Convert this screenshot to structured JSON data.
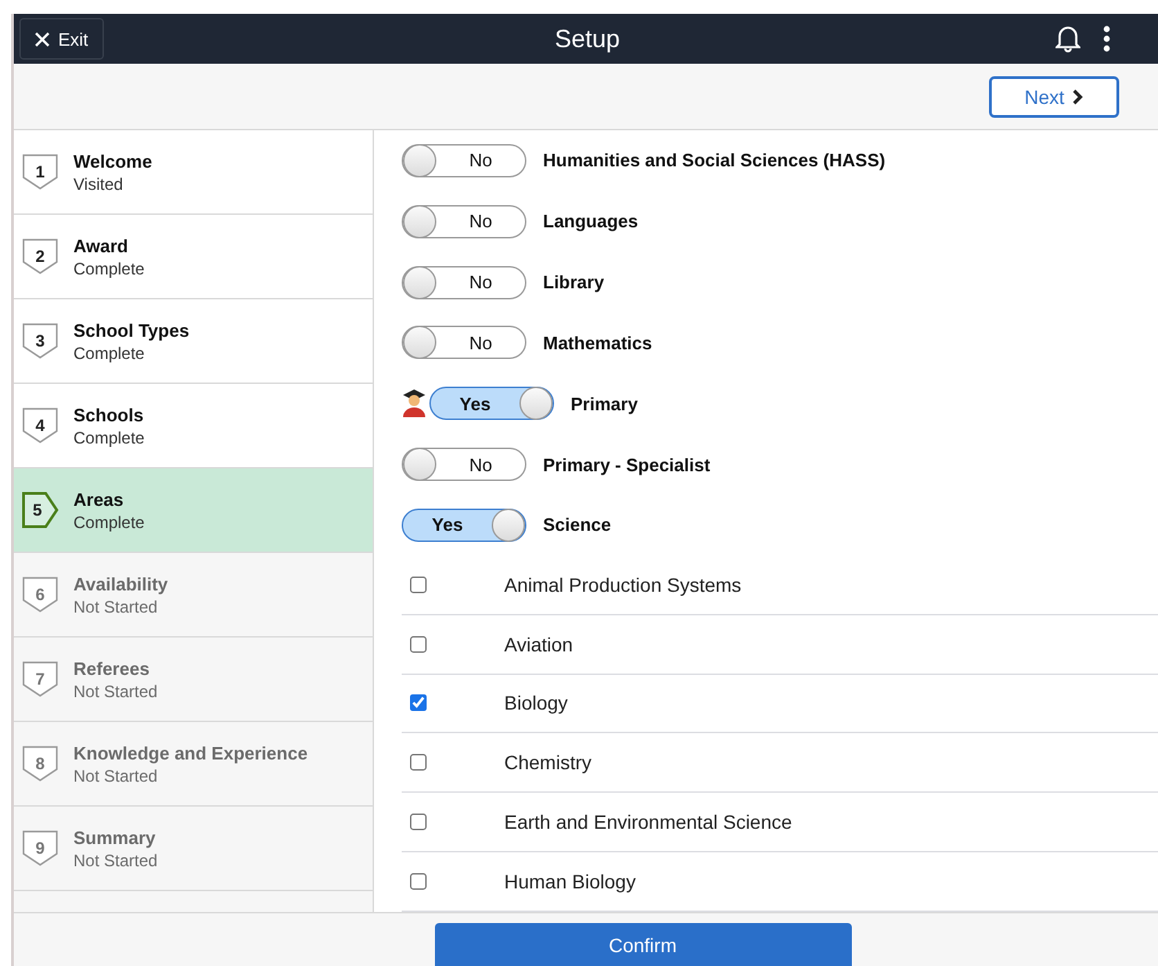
{
  "header": {
    "exit": "Exit",
    "title": "Setup"
  },
  "toolbar": {
    "next": "Next"
  },
  "steps": [
    {
      "number": "1",
      "title": "Welcome",
      "status": "Visited",
      "selected": false,
      "available": true
    },
    {
      "number": "2",
      "title": "Award",
      "status": "Complete",
      "selected": false,
      "available": true
    },
    {
      "number": "3",
      "title": "School Types",
      "status": "Complete",
      "selected": false,
      "available": true
    },
    {
      "number": "4",
      "title": "Schools",
      "status": "Complete",
      "selected": false,
      "available": true
    },
    {
      "number": "5",
      "title": "Areas",
      "status": "Complete",
      "selected": true,
      "available": true
    },
    {
      "number": "6",
      "title": "Availability",
      "status": "Not Started",
      "selected": false,
      "available": false
    },
    {
      "number": "7",
      "title": "Referees",
      "status": "Not Started",
      "selected": false,
      "available": false
    },
    {
      "number": "8",
      "title": "Knowledge and Experience",
      "status": "Not Started",
      "selected": false,
      "available": false
    },
    {
      "number": "9",
      "title": "Summary",
      "status": "Not Started",
      "selected": false,
      "available": false
    }
  ],
  "areas": [
    {
      "label": "Humanities and Social Sciences (HASS)",
      "on": false,
      "toggle_text": "No",
      "flagged": false
    },
    {
      "label": "Languages",
      "on": false,
      "toggle_text": "No",
      "flagged": false
    },
    {
      "label": "Library",
      "on": false,
      "toggle_text": "No",
      "flagged": false
    },
    {
      "label": "Mathematics",
      "on": false,
      "toggle_text": "No",
      "flagged": false
    },
    {
      "label": "Primary",
      "on": true,
      "toggle_text": "Yes",
      "flagged": true
    },
    {
      "label": "Primary - Specialist",
      "on": false,
      "toggle_text": "No",
      "flagged": false
    },
    {
      "label": "Science",
      "on": true,
      "toggle_text": "Yes",
      "flagged": false
    }
  ],
  "subjects": [
    {
      "label": "Animal Production Systems",
      "checked": false
    },
    {
      "label": "Aviation",
      "checked": false
    },
    {
      "label": "Biology",
      "checked": true
    },
    {
      "label": "Chemistry",
      "checked": false
    },
    {
      "label": "Earth and Environmental Science",
      "checked": false
    },
    {
      "label": "Human Biology",
      "checked": false
    }
  ],
  "footer": {
    "confirm": "Confirm"
  }
}
